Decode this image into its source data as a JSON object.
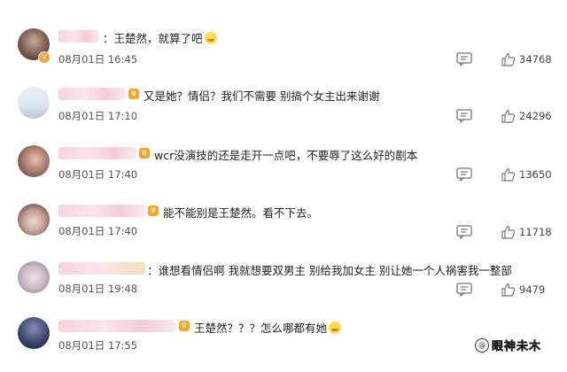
{
  "comments": [
    {
      "text": "：王楚然，就算了吧",
      "date": "08月01日 16:45",
      "likes": "34768",
      "has_emoji": true
    },
    {
      "text": "又是她？情侣？我们不需要 别搞个女主出来谢谢",
      "date": "08月01日 17:10",
      "likes": "24296",
      "has_emoji": false
    },
    {
      "text": "wcr没演技的还是走开一点吧，不要辱了这么好的剧本",
      "date": "08月01日 17:40",
      "likes": "13650",
      "has_emoji": false
    },
    {
      "text": "能不能别是王楚然。看不下去。",
      "date": "08月01日 17:40",
      "likes": "11718",
      "has_emoji": false
    },
    {
      "text": "：谁想看情侣啊 我就想要双男主 别给我加女主 别让她一个人祸害我一整部",
      "date": "08月01日 19:48",
      "likes": "9479",
      "has_emoji": false
    },
    {
      "text": "王楚然？？？怎么哪都有她",
      "date": "08月01日 17:55",
      "likes": "",
      "has_emoji": true
    }
  ],
  "watermark": {
    "text": "眼神未木",
    "icon": "at-icon"
  },
  "icons": {
    "reply": "comment-icon",
    "like": "thumbs-up-icon"
  },
  "colors": {
    "name_blur": "#f7d2db",
    "badge": "#f5a623",
    "emoji": "#ffd84d"
  }
}
